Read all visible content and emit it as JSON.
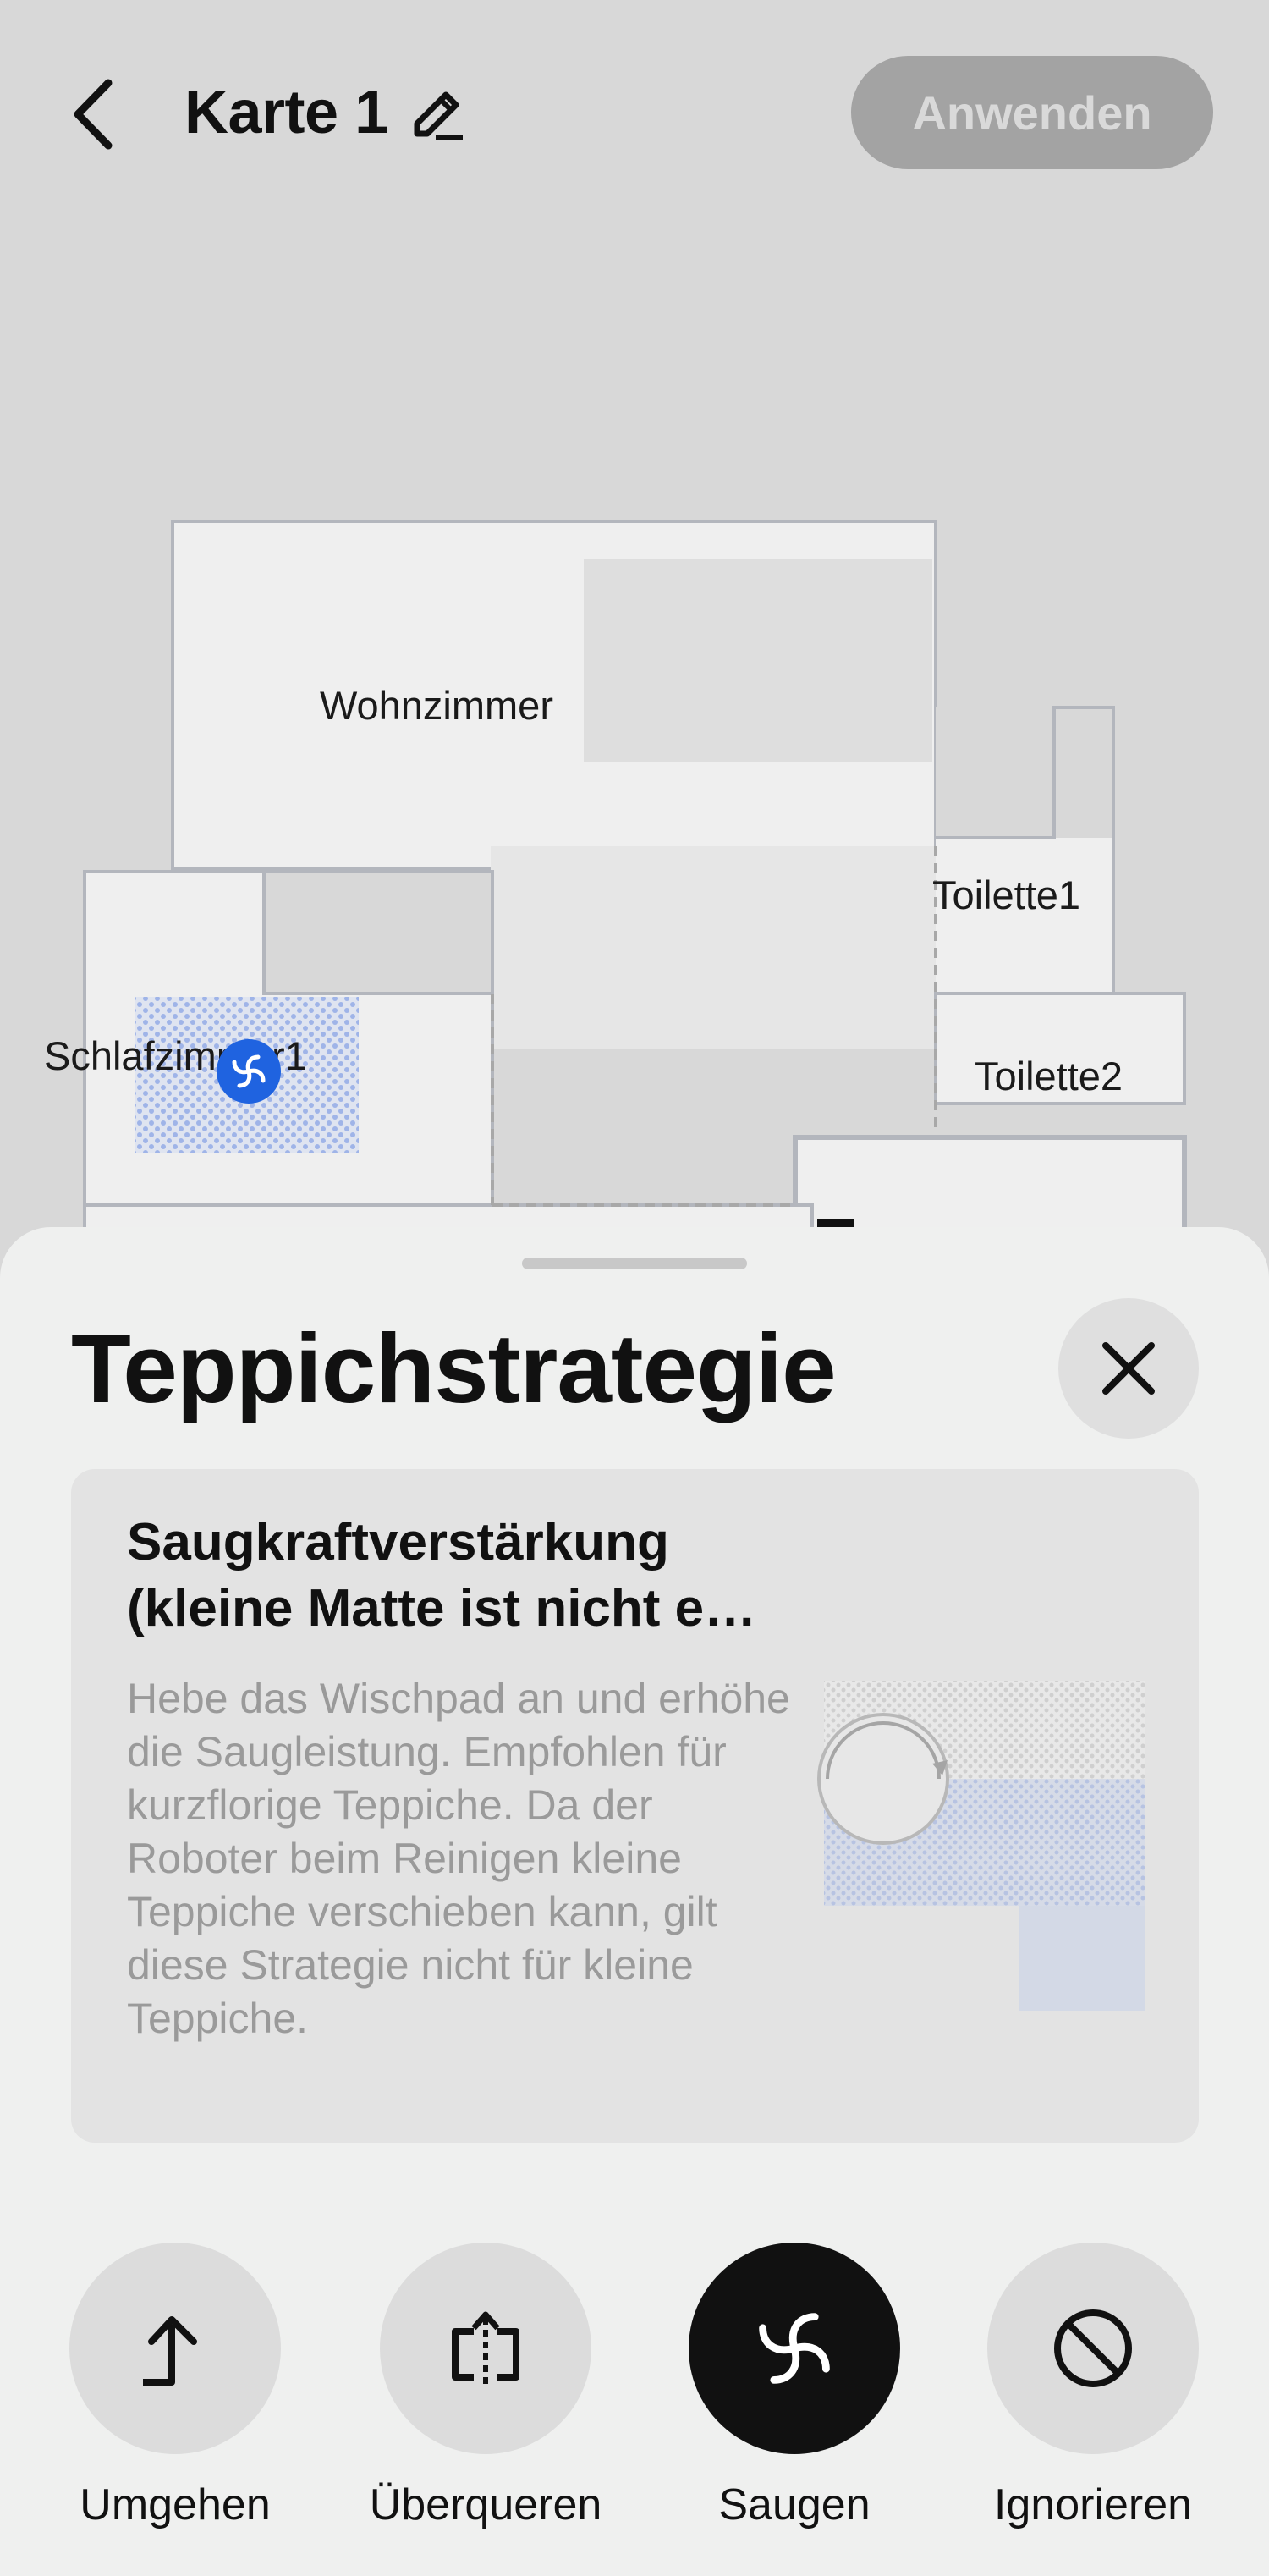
{
  "header": {
    "back_icon": "chevron-left-icon",
    "title": "Karte 1",
    "edit_icon": "pencil-icon",
    "apply_label": "Anwenden"
  },
  "map": {
    "rooms": [
      {
        "id": "wohnzimmer",
        "label": "Wohnzimmer"
      },
      {
        "id": "toilette1",
        "label": "Toilette1"
      },
      {
        "id": "schlafzimmer1",
        "label": "Schlafzimmer1"
      },
      {
        "id": "toilette2",
        "label": "Toilette2"
      }
    ],
    "robot_icon": "vacuum-fan-icon",
    "colors": {
      "carpet": "#6f8fe0",
      "robot": "#1f63e0"
    }
  },
  "sheet": {
    "title": "Teppichstrategie",
    "close_icon": "close-icon",
    "card": {
      "title": "Saugkraftverstärkung (kleine Matte ist nicht e…",
      "description": "Hebe das Wischpad an und erhöhe die Saugleistung. Empfohlen für kurzflorige Teppiche. Da der Roboter beim Reinigen kleine Teppiche verschieben kann, gilt diese Strategie nicht für kleine Teppiche."
    },
    "options": [
      {
        "label": "Umgehen",
        "icon": "avoid-arrow-icon",
        "selected": false
      },
      {
        "label": "Überqueren",
        "icon": "cross-over-icon",
        "selected": false
      },
      {
        "label": "Saugen",
        "icon": "vacuum-fan-icon",
        "selected": true
      },
      {
        "label": "Ignorieren",
        "icon": "ignore-icon",
        "selected": false
      }
    ]
  }
}
